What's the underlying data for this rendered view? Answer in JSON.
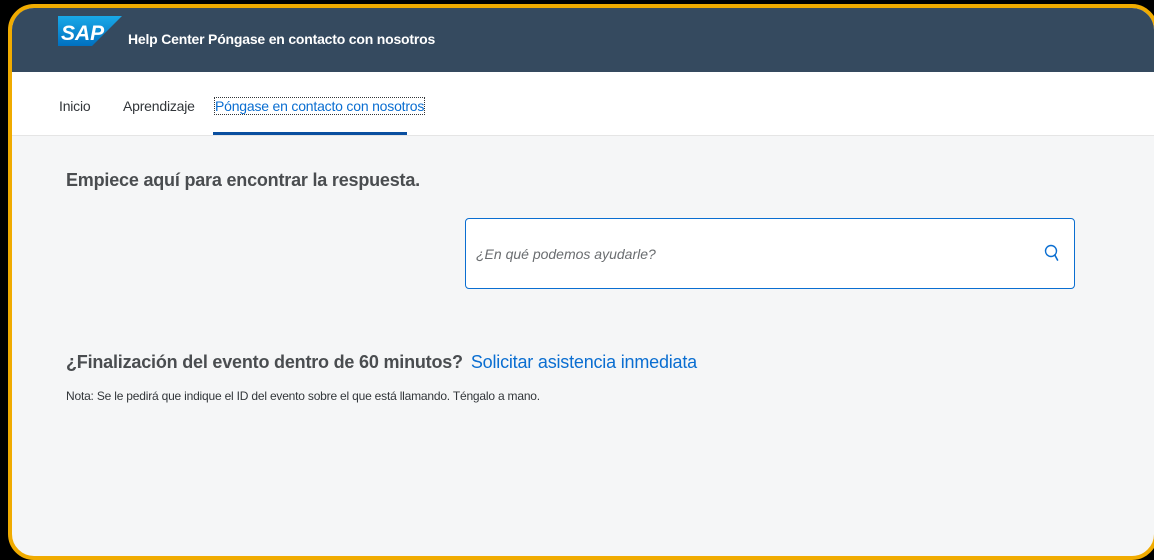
{
  "shell": {
    "logo_text": "SAP",
    "title": "Help Center Póngase en contacto con nosotros"
  },
  "nav": {
    "items": [
      {
        "label": "Inicio"
      },
      {
        "label": "Aprendizaje"
      },
      {
        "label": "Póngase en contacto con nosotros",
        "active": true
      }
    ]
  },
  "main": {
    "heading": "Empiece aquí para encontrar la respuesta.",
    "search": {
      "placeholder": "¿En qué podemos ayudarle?",
      "value": "",
      "icon": "search-icon"
    },
    "event": {
      "question": "¿Finalización del evento dentro de 60 minutos?",
      "link": "Solicitar asistencia inmediata"
    },
    "note": "Nota: Se le pedirá que indique el ID del evento sobre el que está llamando. Téngalo a mano."
  },
  "colors": {
    "shellbar": "#354a5f",
    "accent": "#0a6ed1",
    "frame_border": "#f0ab00",
    "background": "#f5f6f7"
  }
}
